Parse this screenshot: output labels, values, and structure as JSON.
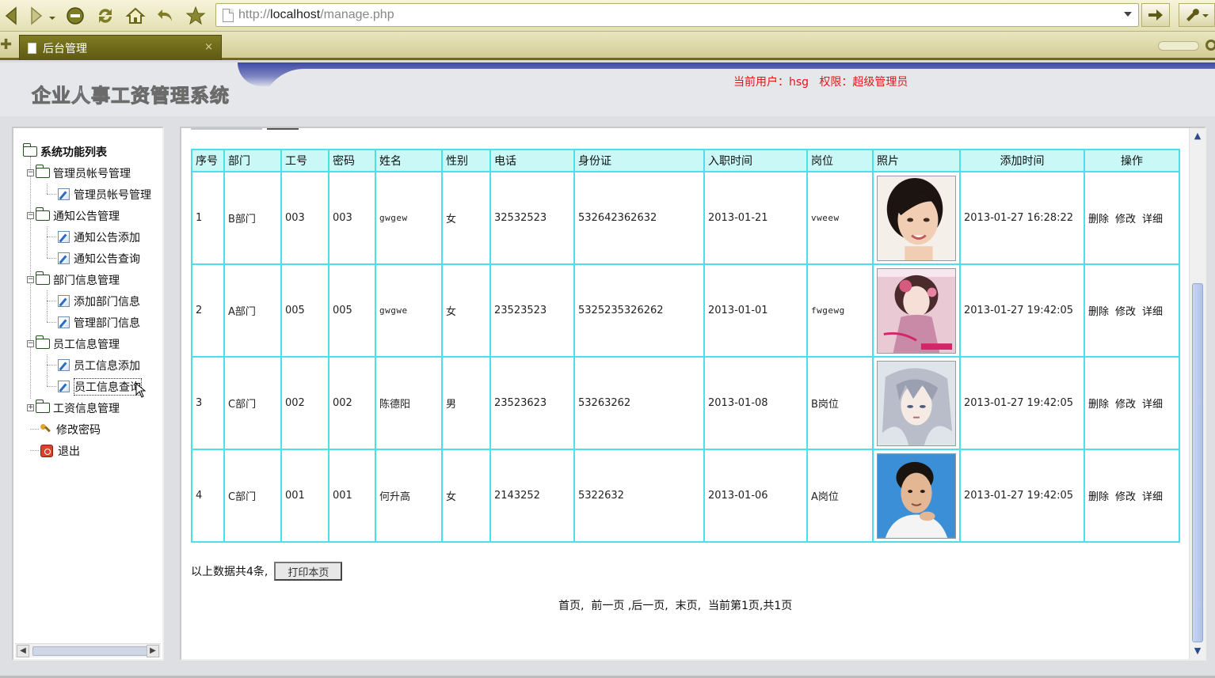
{
  "browser": {
    "url": "http://localhost/manage.php",
    "url_scheme": "http://",
    "url_host": "localhost",
    "url_path": "/manage.php",
    "tab_title": "后台管理",
    "tab_close": "×"
  },
  "header": {
    "site_title": "企业人事工资管理系统",
    "user_info": "当前用户：hsg   权限：超级管理员"
  },
  "sidebar": {
    "root_label": "系统功能列表",
    "groups": [
      {
        "label": "管理员帐号管理",
        "items": [
          "管理员帐号管理"
        ]
      },
      {
        "label": "通知公告管理",
        "items": [
          "通知公告添加",
          "通知公告查询"
        ]
      },
      {
        "label": "部门信息管理",
        "items": [
          "添加部门信息",
          "管理部门信息"
        ]
      },
      {
        "label": "员工信息管理",
        "items": [
          "员工信息添加",
          "员工信息查询"
        ]
      },
      {
        "label": "工资信息管理",
        "items": []
      }
    ],
    "change_password": "修改密码",
    "logout": "退出"
  },
  "table": {
    "headers": [
      "序号",
      "部门",
      "工号",
      "密码",
      "姓名",
      "性别",
      "电话",
      "身份证",
      "入职时间",
      "岗位",
      "照片",
      "添加时间",
      "操作"
    ],
    "rows": [
      {
        "no": "1",
        "dept": "B部门",
        "emp_id": "003",
        "password": "003",
        "name": "gwgew",
        "gender": "女",
        "phone": "32532523",
        "id_card": "532642362632",
        "hire_date": "2013-01-21",
        "position": "vweew",
        "added": "2013-01-27 16:28:22"
      },
      {
        "no": "2",
        "dept": "A部门",
        "emp_id": "005",
        "password": "005",
        "name": "gwgwe",
        "gender": "女",
        "phone": "23523523",
        "id_card": "5325235326262",
        "hire_date": "2013-01-01",
        "position": "fwgewg",
        "added": "2013-01-27 19:42:05"
      },
      {
        "no": "3",
        "dept": "C部门",
        "emp_id": "002",
        "password": "002",
        "name": "陈德阳",
        "gender": "男",
        "phone": "23523623",
        "id_card": "53263262",
        "hire_date": "2013-01-08",
        "position": "B岗位",
        "added": "2013-01-27 19:42:05"
      },
      {
        "no": "4",
        "dept": "C部门",
        "emp_id": "001",
        "password": "001",
        "name": "何升高",
        "gender": "女",
        "phone": "2143252",
        "id_card": "5322632",
        "hire_date": "2013-01-06",
        "position": "A岗位",
        "added": "2013-01-27 19:42:05"
      }
    ],
    "ops": {
      "delete": "删除",
      "edit": "修改",
      "detail": "详细"
    }
  },
  "footer": {
    "total_text": "以上数据共4条,",
    "print_label": "打印本页",
    "pager": {
      "first": "首页",
      "prev": "前一页",
      "next": "后一页",
      "last": "末页",
      "current": "当前第1页,共1页"
    }
  },
  "colors": {
    "table_border": "#4ddfe7",
    "header_bg": "#c9f8f7",
    "user_info": "#e0161b",
    "banner_blue": "#3e4aa3"
  }
}
